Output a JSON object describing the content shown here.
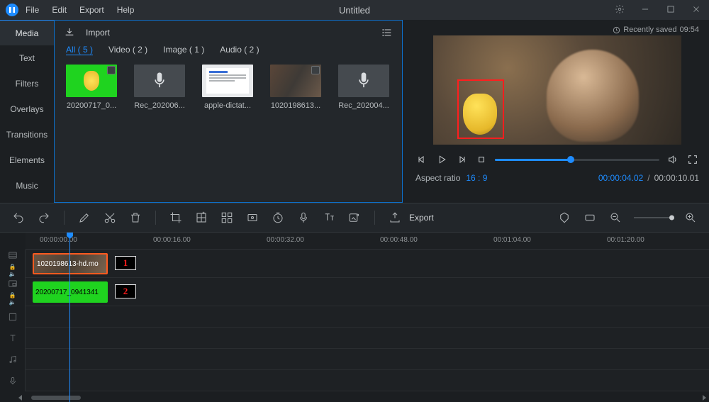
{
  "titlebar": {
    "menu": [
      "File",
      "Edit",
      "Export",
      "Help"
    ],
    "title": "Untitled"
  },
  "saved_status": {
    "prefix": "Recently saved ",
    "time": "09:54"
  },
  "side_tabs": [
    "Media",
    "Text",
    "Filters",
    "Overlays",
    "Transitions",
    "Elements",
    "Music"
  ],
  "import_label": "Import",
  "filters": [
    {
      "label": "All ( 5 )",
      "active": true
    },
    {
      "label": "Video ( 2 )",
      "active": false
    },
    {
      "label": "Image ( 1 )",
      "active": false
    },
    {
      "label": "Audio ( 2 )",
      "active": false
    }
  ],
  "thumbnails": [
    {
      "name": "20200717_0...",
      "kind": "green"
    },
    {
      "name": "Rec_202006...",
      "kind": "audio"
    },
    {
      "name": "apple-dictat...",
      "kind": "doc"
    },
    {
      "name": "1020198613...",
      "kind": "video"
    },
    {
      "name": "Rec_202004...",
      "kind": "audio"
    }
  ],
  "aspect": {
    "label": "Aspect ratio",
    "value": "16 : 9"
  },
  "time": {
    "current": "00:00:04.02",
    "total": "00:00:10.01"
  },
  "toolbar": {
    "export_label": "Export"
  },
  "ruler_labels": [
    "00:00:00.00",
    "00:00:16.00",
    "00:00:32.00",
    "00:00:48.00",
    "00:01:04.00",
    "00:01:20.00"
  ],
  "clips": {
    "track1": {
      "label": "1020198613-hd.mo"
    },
    "track2": {
      "label": "20200717_0941341"
    }
  },
  "annotations": {
    "one": "1",
    "two": "2"
  }
}
